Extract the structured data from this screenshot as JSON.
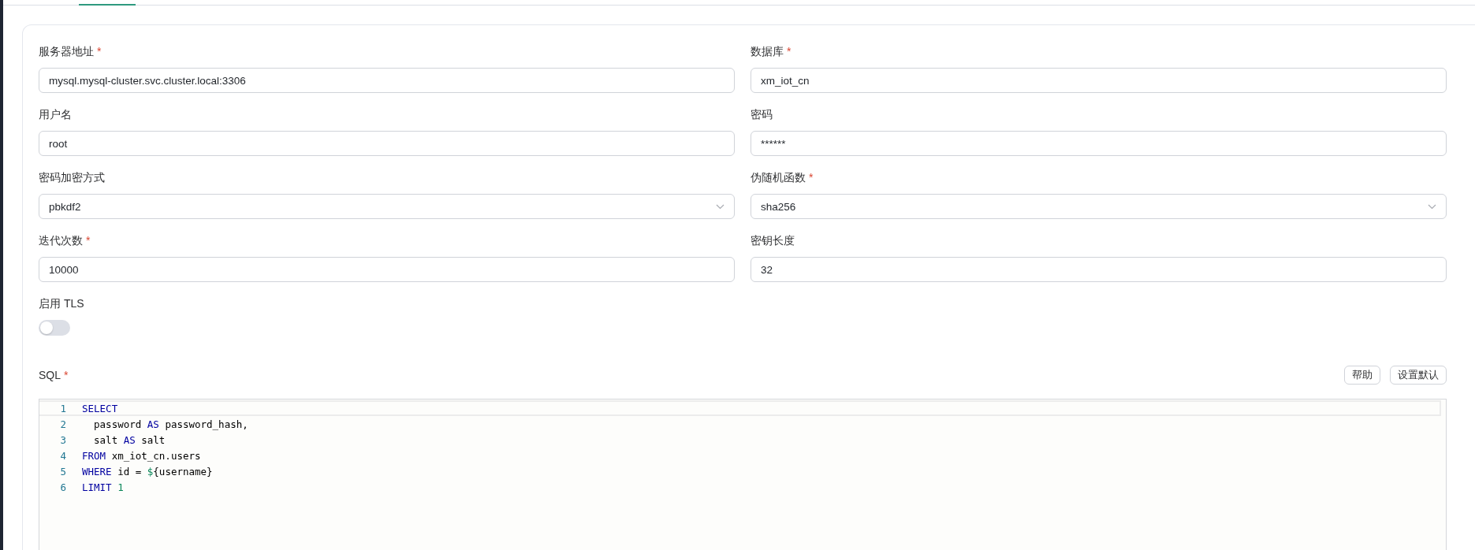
{
  "fields": [
    {
      "label": "服务器地址",
      "required_mark": "*",
      "kind": "text",
      "value": "mysql.mysql-cluster.svc.cluster.local:3306"
    },
    {
      "label": "数据库",
      "required_mark": "*",
      "kind": "text",
      "value": "xm_iot_cn"
    },
    {
      "label": "用户名",
      "kind": "text",
      "value": "root"
    },
    {
      "label": "密码",
      "kind": "text",
      "value": "******"
    },
    {
      "label": "密码加密方式",
      "kind": "select",
      "value": "pbkdf2"
    },
    {
      "label": "伪随机函数",
      "required_mark": "*",
      "kind": "select",
      "value": "sha256"
    },
    {
      "label": "迭代次数",
      "required_mark": "*",
      "kind": "text",
      "value": "10000"
    },
    {
      "label": "密钥长度",
      "kind": "text",
      "value": "32"
    }
  ],
  "tls": {
    "label": "启用 TLS",
    "on": false
  },
  "sql": {
    "label": "SQL",
    "required_mark": "*",
    "buttons": [
      "帮助",
      "设置默认"
    ],
    "lines": [
      {
        "number": "1",
        "active": true,
        "tokens": [
          {
            "kind": "keyword",
            "text": "SELECT"
          }
        ]
      },
      {
        "number": "2",
        "active": false,
        "tokens": [
          {
            "kind": "plain",
            "text": "  password "
          },
          {
            "kind": "keyword",
            "text": "AS"
          },
          {
            "kind": "plain",
            "text": " password_hash,"
          }
        ]
      },
      {
        "number": "3",
        "active": false,
        "tokens": [
          {
            "kind": "plain",
            "text": "  salt "
          },
          {
            "kind": "keyword",
            "text": "AS"
          },
          {
            "kind": "plain",
            "text": " salt"
          }
        ]
      },
      {
        "number": "4",
        "active": false,
        "tokens": [
          {
            "kind": "keyword",
            "text": "FROM"
          },
          {
            "kind": "plain",
            "text": " xm_iot_cn.users"
          }
        ]
      },
      {
        "number": "5",
        "active": false,
        "tokens": [
          {
            "kind": "keyword",
            "text": "WHERE"
          },
          {
            "kind": "plain",
            "text": " id = "
          },
          {
            "kind": "variable",
            "text": "$"
          },
          {
            "kind": "plain",
            "text": "{username}"
          }
        ]
      },
      {
        "number": "6",
        "active": false,
        "tokens": [
          {
            "kind": "keyword",
            "text": "LIMIT"
          },
          {
            "kind": "number",
            "text": " 1"
          }
        ]
      }
    ]
  }
}
